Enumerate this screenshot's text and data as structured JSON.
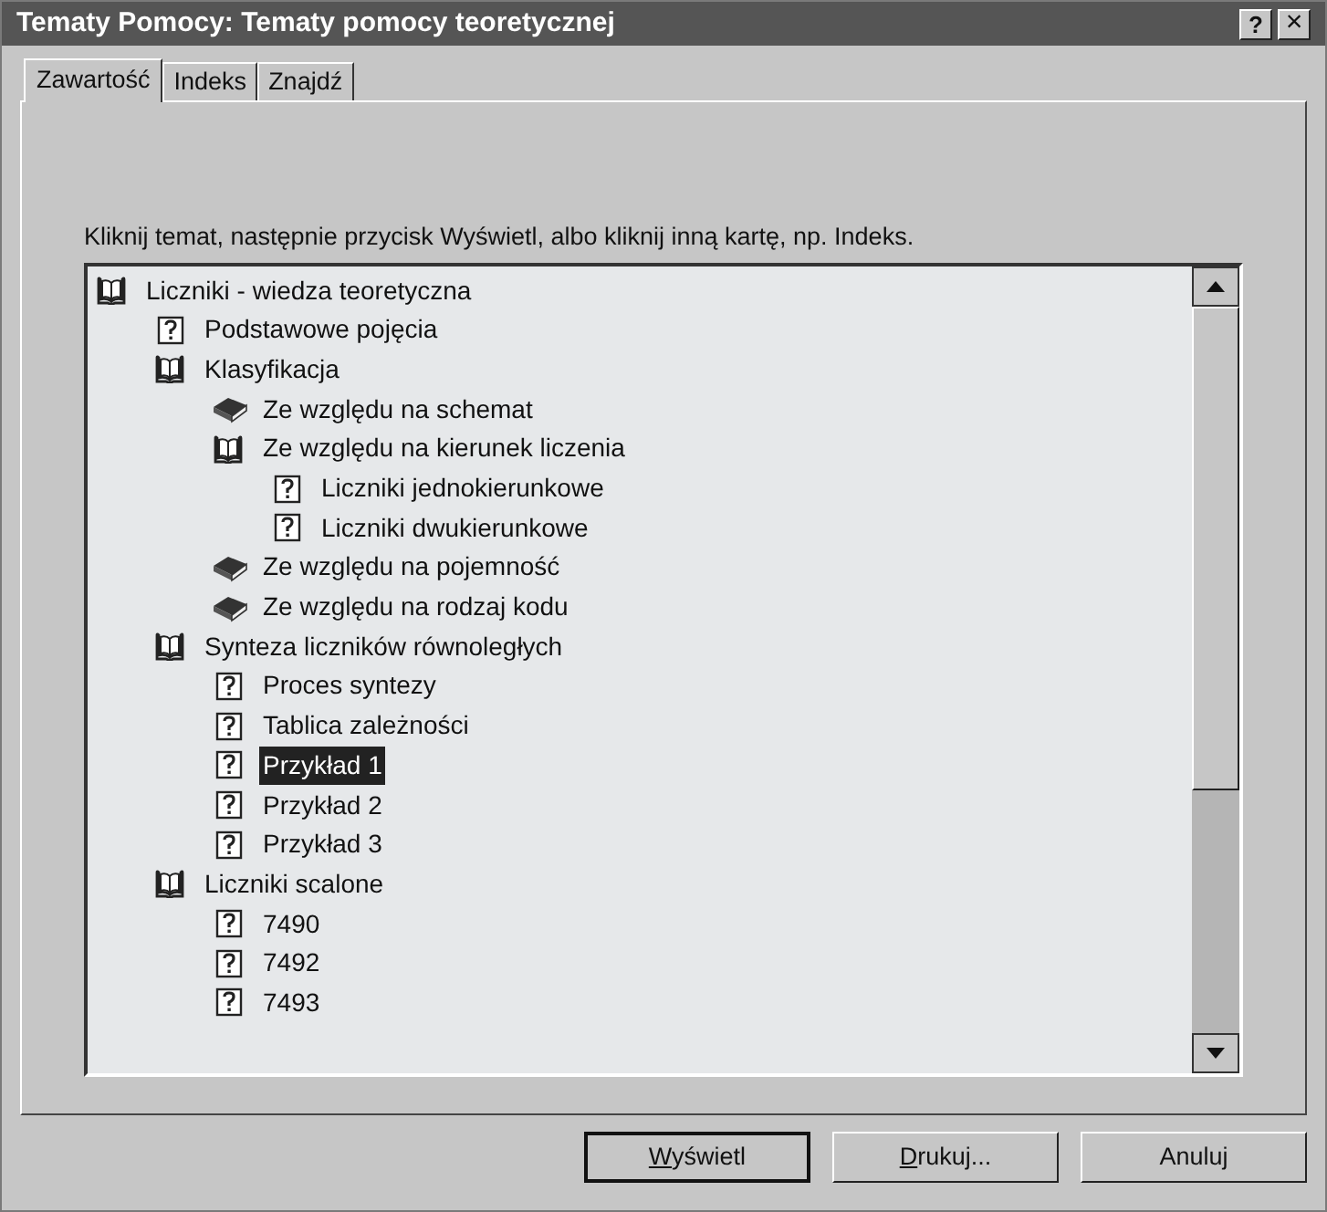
{
  "window": {
    "title": "Tematy Pomocy: Tematy pomocy teoretycznej",
    "title_buttons": [
      {
        "kind": "help",
        "label": "?"
      },
      {
        "kind": "close",
        "label": "×"
      }
    ]
  },
  "tabs": [
    {
      "label": "Zawartość",
      "selected": true
    },
    {
      "label": "Indeks",
      "selected": false
    },
    {
      "label": "Znajdź",
      "selected": false
    }
  ],
  "instruction": "Kliknij temat, następnie przycisk Wyświetl, albo kliknij inną kartę, np. Indeks.",
  "tree": [
    {
      "kind": "book",
      "expanded": true,
      "label": "Liczniki - wiedza teoretyczna",
      "selected": false,
      "children": [
        {
          "kind": "topic",
          "label": "Podstawowe pojęcia",
          "selected": false
        },
        {
          "kind": "book",
          "expanded": true,
          "label": "Klasyfikacja",
          "selected": false,
          "children": [
            {
              "kind": "book",
              "expanded": false,
              "label": "Ze względu na schemat",
              "selected": false
            },
            {
              "kind": "book",
              "expanded": true,
              "label": "Ze względu na kierunek liczenia",
              "selected": false,
              "children": [
                {
                  "kind": "topic",
                  "label": "Liczniki jednokierunkowe",
                  "selected": false
                },
                {
                  "kind": "topic",
                  "label": "Liczniki dwukierunkowe",
                  "selected": false
                }
              ]
            },
            {
              "kind": "book",
              "expanded": false,
              "label": "Ze względu na pojemność",
              "selected": false
            },
            {
              "kind": "book",
              "expanded": false,
              "label": "Ze względu na rodzaj kodu",
              "selected": false
            }
          ]
        },
        {
          "kind": "book",
          "expanded": true,
          "label": "Synteza liczników równoległych",
          "selected": false,
          "children": [
            {
              "kind": "topic",
              "label": "Proces syntezy",
              "selected": false
            },
            {
              "kind": "topic",
              "label": "Tablica zależności",
              "selected": false
            },
            {
              "kind": "topic",
              "label": "Przykład 1",
              "selected": true
            },
            {
              "kind": "topic",
              "label": "Przykład 2",
              "selected": false
            },
            {
              "kind": "topic",
              "label": "Przykład 3",
              "selected": false
            }
          ]
        },
        {
          "kind": "book",
          "expanded": true,
          "label": "Liczniki scalone",
          "selected": false,
          "children": [
            {
              "kind": "topic",
              "label": "7490",
              "selected": false
            },
            {
              "kind": "topic",
              "label": "7492",
              "selected": false
            },
            {
              "kind": "topic",
              "label": "7493",
              "selected": false
            }
          ]
        }
      ]
    }
  ],
  "buttons": [
    {
      "label": "Wyświetl",
      "default": true,
      "underline_first": true
    },
    {
      "label": "Drukuj...",
      "default": false,
      "underline_first": true
    },
    {
      "label": "Anuluj",
      "default": false,
      "underline_first": false
    }
  ]
}
